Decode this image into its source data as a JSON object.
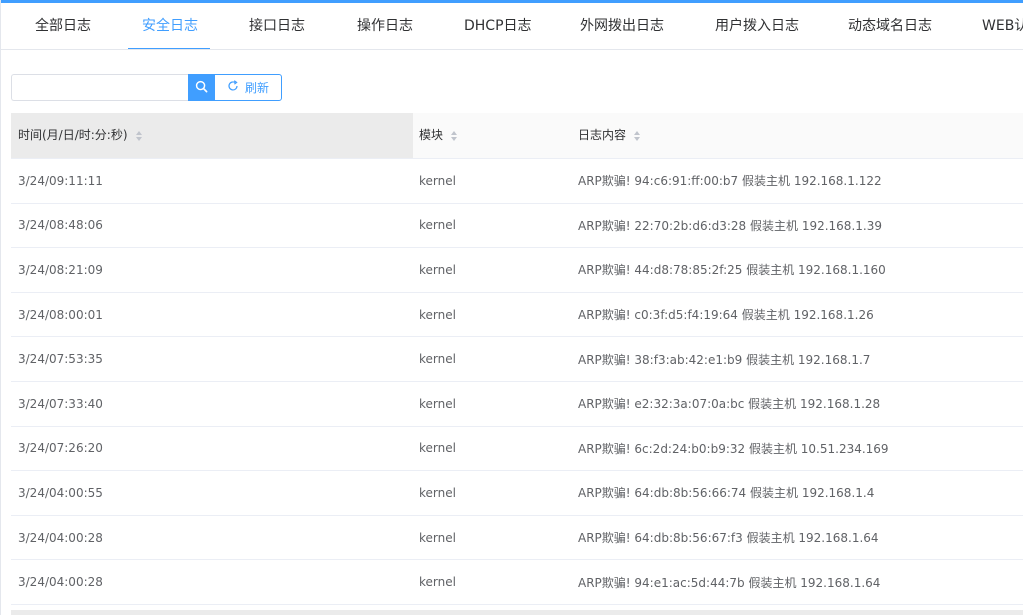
{
  "tabs": [
    {
      "label": "全部日志",
      "active": false
    },
    {
      "label": "安全日志",
      "active": true
    },
    {
      "label": "接口日志",
      "active": false
    },
    {
      "label": "操作日志",
      "active": false
    },
    {
      "label": "DHCP日志",
      "active": false
    },
    {
      "label": "外网拨出日志",
      "active": false
    },
    {
      "label": "用户拨入日志",
      "active": false
    },
    {
      "label": "动态域名日志",
      "active": false
    },
    {
      "label": "WEB认",
      "active": false
    }
  ],
  "search": {
    "value": "",
    "placeholder": "",
    "search_icon": "search-icon",
    "refresh_label": "刷新",
    "refresh_icon": "refresh-icon"
  },
  "table": {
    "columns": [
      {
        "label": "时间(月/日/时:分:秒)",
        "sortable": true
      },
      {
        "label": "模块",
        "sortable": true
      },
      {
        "label": "日志内容",
        "sortable": true
      }
    ],
    "rows": [
      {
        "time": "3/24/09:11:11",
        "module": "kernel",
        "content": "ARP欺骗! 94:c6:91:ff:00:b7 假装主机 192.168.1.122"
      },
      {
        "time": "3/24/08:48:06",
        "module": "kernel",
        "content": "ARP欺骗! 22:70:2b:d6:d3:28 假装主机 192.168.1.39"
      },
      {
        "time": "3/24/08:21:09",
        "module": "kernel",
        "content": "ARP欺骗! 44:d8:78:85:2f:25 假装主机 192.168.1.160"
      },
      {
        "time": "3/24/08:00:01",
        "module": "kernel",
        "content": "ARP欺骗! c0:3f:d5:f4:19:64 假装主机 192.168.1.26"
      },
      {
        "time": "3/24/07:53:35",
        "module": "kernel",
        "content": "ARP欺骗! 38:f3:ab:42:e1:b9 假装主机 192.168.1.7"
      },
      {
        "time": "3/24/07:33:40",
        "module": "kernel",
        "content": "ARP欺骗! e2:32:3a:07:0a:bc 假装主机 192.168.1.28"
      },
      {
        "time": "3/24/07:26:20",
        "module": "kernel",
        "content": "ARP欺骗! 6c:2d:24:b0:b9:32 假装主机 10.51.234.169"
      },
      {
        "time": "3/24/04:00:55",
        "module": "kernel",
        "content": "ARP欺骗! 64:db:8b:56:66:74 假装主机 192.168.1.4"
      },
      {
        "time": "3/24/04:00:28",
        "module": "kernel",
        "content": "ARP欺骗! 64:db:8b:56:67:f3 假装主机 192.168.1.64"
      },
      {
        "time": "3/24/04:00:28",
        "module": "kernel",
        "content": "ARP欺骗! 94:e1:ac:5d:44:7b 假装主机 192.168.1.64"
      }
    ]
  },
  "colors": {
    "accent": "#409eff",
    "text": "#606266",
    "header_text": "#303133",
    "border": "#ebeef5",
    "sorted_header_bg": "#ebebeb"
  }
}
